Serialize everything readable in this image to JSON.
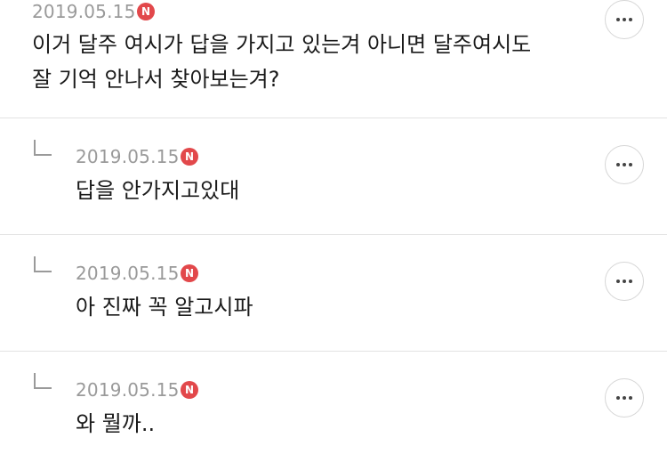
{
  "badge_letter": "N",
  "comments": [
    {
      "date": "2019.05.15",
      "lines": [
        "이거 달주 여시가 답을 가지고 있는겨 아니면 달주여시도",
        "잘 기억 안나서 찾아보는겨?"
      ]
    },
    {
      "date": "2019.05.15",
      "lines": [
        "답을 안가지고있대"
      ]
    },
    {
      "date": "2019.05.15",
      "lines": [
        "아 진짜 꼭 알고시파"
      ]
    },
    {
      "date": "2019.05.15",
      "lines": [
        "와 뭘까.."
      ]
    }
  ]
}
